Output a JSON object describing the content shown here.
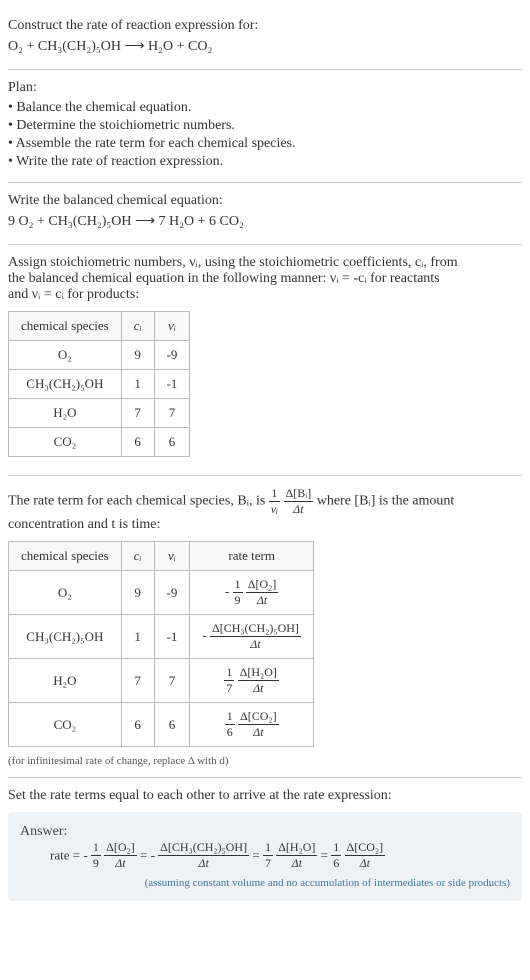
{
  "s1": {
    "title": "Construct the rate of reaction expression for:",
    "eq": "O₂ + CH₃(CH₂)₅OH ⟶ H₂O + CO₂"
  },
  "s2": {
    "title": "Plan:",
    "items": [
      "• Balance the chemical equation.",
      "• Determine the stoichiometric numbers.",
      "• Assemble the rate term for each chemical species.",
      "• Write the rate of reaction expression."
    ]
  },
  "s3": {
    "title": "Write the balanced chemical equation:",
    "eq": "9 O₂ + CH₃(CH₂)₅OH ⟶ 7 H₂O + 6 CO₂"
  },
  "s4": {
    "intro1": "Assign stoichiometric numbers, νᵢ, using the stoichiometric coefficients, cᵢ, from",
    "intro2": "the balanced chemical equation in the following manner: νᵢ = -cᵢ for reactants",
    "intro3": "and νᵢ = cᵢ for products:",
    "headers": [
      "chemical species",
      "cᵢ",
      "νᵢ"
    ],
    "rows": [
      [
        "O₂",
        "9",
        "-9"
      ],
      [
        "CH₃(CH₂)₅OH",
        "1",
        "-1"
      ],
      [
        "H₂O",
        "7",
        "7"
      ],
      [
        "CO₂",
        "6",
        "6"
      ]
    ]
  },
  "s5": {
    "intro_a": "The rate term for each chemical species, Bᵢ, is ",
    "frac1_num": "1",
    "frac1_den": "νᵢ",
    "frac2_num": "Δ[Bᵢ]",
    "frac2_den": "Δt",
    "intro_b": " where [Bᵢ] is the amount",
    "intro_c": "concentration and t is time:",
    "headers": [
      "chemical species",
      "cᵢ",
      "νᵢ",
      "rate term"
    ],
    "rows": [
      {
        "sp": "O₂",
        "c": "9",
        "v": "-9",
        "neg": "-",
        "fn1": "1",
        "fd1": "9",
        "fn2": "Δ[O₂]",
        "fd2": "Δt"
      },
      {
        "sp": "CH₃(CH₂)₅OH",
        "c": "1",
        "v": "-1",
        "neg": "-",
        "fn1": "",
        "fd1": "",
        "fn2": "Δ[CH₃(CH₂)₅OH]",
        "fd2": "Δt"
      },
      {
        "sp": "H₂O",
        "c": "7",
        "v": "7",
        "neg": "",
        "fn1": "1",
        "fd1": "7",
        "fn2": "Δ[H₂O]",
        "fd2": "Δt"
      },
      {
        "sp": "CO₂",
        "c": "6",
        "v": "6",
        "neg": "",
        "fn1": "1",
        "fd1": "6",
        "fn2": "Δ[CO₂]",
        "fd2": "Δt"
      }
    ],
    "note": "(for infinitesimal rate of change, replace Δ with d)"
  },
  "s6": {
    "title": "Set the rate terms equal to each other to arrive at the rate expression:"
  },
  "answer": {
    "label": "Answer:",
    "prefix": "rate = ",
    "t1_neg": "-",
    "t1_fn1": "1",
    "t1_fd1": "9",
    "t1_fn2": "Δ[O₂]",
    "t1_fd2": "Δt",
    "eq1": " = ",
    "t2_neg": "-",
    "t2_fn2": "Δ[CH₃(CH₂)₅OH]",
    "t2_fd2": "Δt",
    "eq2": " = ",
    "t3_fn1": "1",
    "t3_fd1": "7",
    "t3_fn2": "Δ[H₂O]",
    "t3_fd2": "Δt",
    "eq3": " = ",
    "t4_fn1": "1",
    "t4_fd1": "6",
    "t4_fn2": "Δ[CO₂]",
    "t4_fd2": "Δt",
    "note": "(assuming constant volume and no accumulation of intermediates or side products)"
  }
}
